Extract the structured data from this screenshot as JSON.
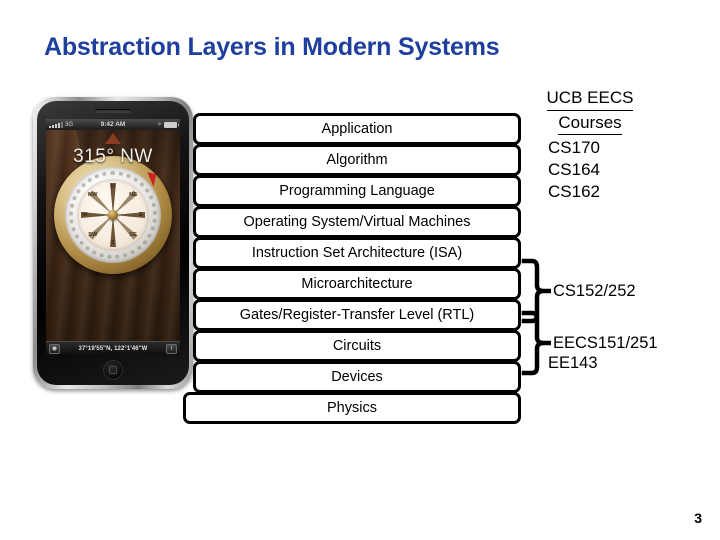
{
  "slide": {
    "title": "Abstraction Layers in Modern Systems",
    "title_color": "#1F3F9E",
    "page_number": "3"
  },
  "layers": [
    {
      "label": "Application"
    },
    {
      "label": "Algorithm"
    },
    {
      "label": "Programming Language"
    },
    {
      "label": "Operating System/Virtual Machines"
    },
    {
      "label": "Instruction Set Architecture (ISA)"
    },
    {
      "label": "Microarchitecture"
    },
    {
      "label": "Gates/Register-Transfer Level (RTL)"
    },
    {
      "label": "Circuits"
    },
    {
      "label": "Devices"
    },
    {
      "label": "Physics"
    }
  ],
  "courses": {
    "heading_line1": "UCB EECS",
    "heading_line2": "Courses",
    "items": [
      {
        "label": "CS170"
      },
      {
        "label": "CS164"
      },
      {
        "label": "CS162"
      }
    ]
  },
  "annotations": [
    {
      "label": "CS152/252"
    },
    {
      "label": "EECS151/251"
    },
    {
      "label": "EE143"
    }
  ],
  "phone": {
    "status_bar": {
      "carrier": "3G",
      "time": "9:42 AM",
      "bluetooth_icon": "bluetooth-icon",
      "battery_icon": "battery-icon"
    },
    "heading_readout": "315° NW",
    "coordinates": "37°19'55\"N, 122°1'46\"W",
    "left_button_icon": "target-icon",
    "right_button_icon": "info-icon",
    "compass_labels": [
      "N",
      "NE",
      "E",
      "SE",
      "S",
      "SW",
      "W",
      "NW"
    ]
  }
}
